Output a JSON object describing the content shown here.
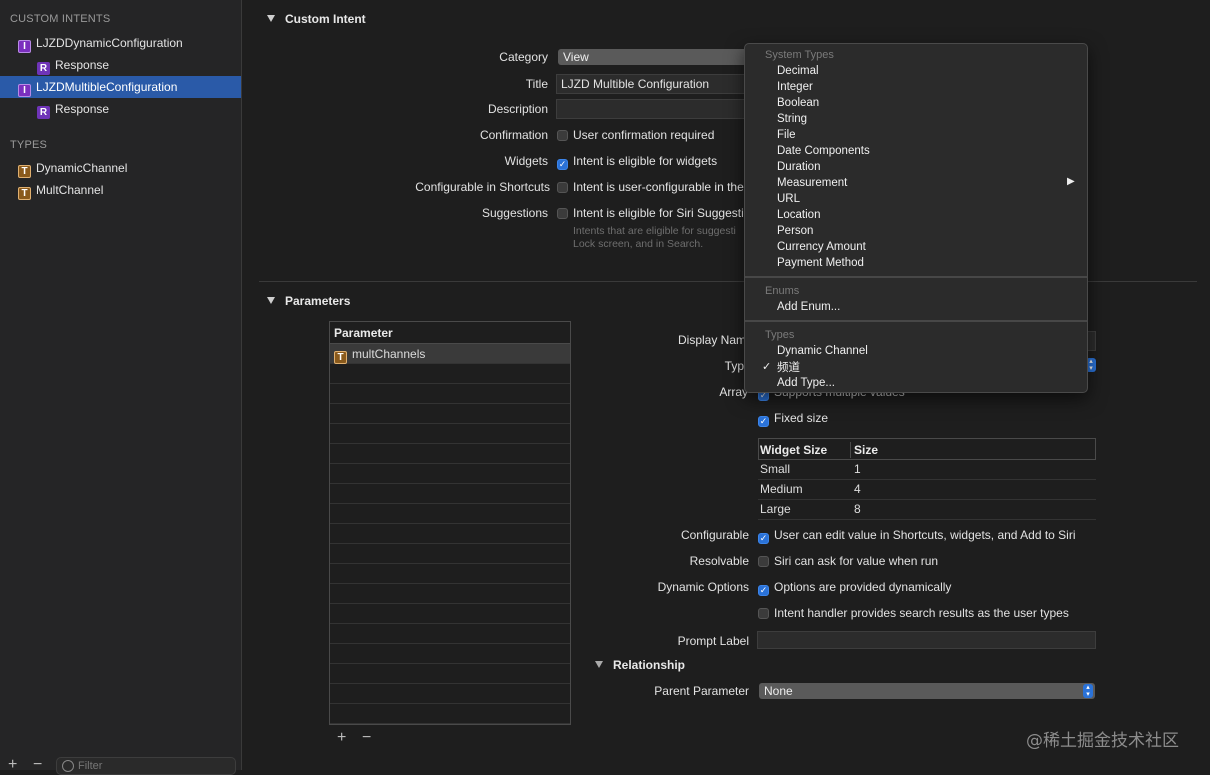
{
  "sidebar": {
    "section_intents": "CUSTOM INTENTS",
    "intents": [
      {
        "badge": "I",
        "label": "LJZDDynamicConfiguration"
      },
      {
        "badge": "R",
        "label": "Response"
      },
      {
        "badge": "I",
        "label": "LJZDMultibleConfiguration"
      },
      {
        "badge": "R",
        "label": "Response"
      }
    ],
    "section_types": "TYPES",
    "types": [
      {
        "badge": "T",
        "label": "DynamicChannel"
      },
      {
        "badge": "T",
        "label": "MultChannel"
      }
    ],
    "add_symbol": "+",
    "remove_symbol": "−",
    "filter_placeholder": "Filter"
  },
  "custom_intent": {
    "heading": "Custom Intent",
    "category_label": "Category",
    "category_value": "View",
    "title_label": "Title",
    "title_value": "LJZD Multible Configuration",
    "description_label": "Description",
    "confirmation_label": "Confirmation",
    "confirmation_text": "User confirmation required",
    "widgets_label": "Widgets",
    "widgets_text": "Intent is eligible for widgets",
    "shortcuts_label": "Configurable in Shortcuts",
    "shortcuts_text": "Intent is user-configurable in the",
    "suggestions_label": "Suggestions",
    "suggestions_text": "Intent is eligible for Siri Suggesti",
    "hint_line1": "Intents that are eligible for suggesti",
    "hint_line2": "Lock screen, and in Search."
  },
  "parameters": {
    "heading": "Parameters",
    "table_header": "Parameter",
    "rows": [
      {
        "badge": "T",
        "label": "multChannels"
      }
    ],
    "display_name_label": "Display Nam",
    "type_label": "Typ",
    "array_label": "Array",
    "array_text": "Supports multiple values",
    "fixed_size_text": "Fixed size",
    "size_table": {
      "headers": [
        "Widget Size",
        "Size"
      ],
      "rows": [
        [
          "Small",
          "1"
        ],
        [
          "Medium",
          "4"
        ],
        [
          "Large",
          "8"
        ]
      ]
    },
    "configurable_label": "Configurable",
    "configurable_text": "User can edit value in Shortcuts, widgets, and Add to Siri",
    "resolvable_label": "Resolvable",
    "resolvable_text": "Siri can ask for value when run",
    "dynamic_label": "Dynamic Options",
    "dynamic_text": "Options are provided dynamically",
    "search_text": "Intent handler provides search results as the user types",
    "prompt_label": "Prompt Label",
    "relationship_heading": "Relationship",
    "parent_label": "Parent Parameter",
    "parent_value": "None",
    "add_symbol": "+",
    "remove_symbol": "−"
  },
  "menu": {
    "system_header": "System Types",
    "system_items": [
      "Decimal",
      "Integer",
      "Boolean",
      "String",
      "File",
      "Date Components",
      "Duration",
      "Measurement",
      "URL",
      "Location",
      "Person",
      "Currency Amount",
      "Payment Method"
    ],
    "submenu_arrow": "▶",
    "enums_header": "Enums",
    "add_enum": "Add Enum...",
    "types_header": "Types",
    "type_items": [
      "Dynamic Channel",
      "频道"
    ],
    "checkmark": "✓",
    "add_type": "Add Type..."
  },
  "watermark": "@稀土掘金技术社区"
}
